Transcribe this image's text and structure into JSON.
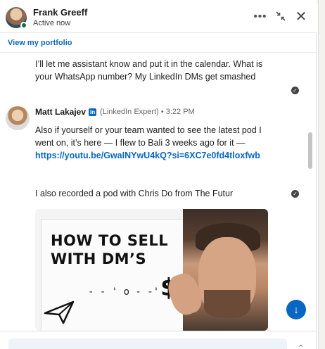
{
  "header": {
    "name": "Frank Greeff",
    "status": "Active now",
    "more_icon": "•••",
    "minimize_icon": "↘↖",
    "close_icon": "✕"
  },
  "portfolio": {
    "label": "View my portfolio"
  },
  "messages": {
    "first": {
      "text": "I’ll let me assistant know and put it in the calendar. What is your WhatsApp number? My LinkedIn DMs get smashed"
    },
    "second": {
      "sender": "Matt Lakajev",
      "badge": "in",
      "meta": "(LinkedIn Expert) • 3:22 PM",
      "text_before": "Also if yourself or your team wanted to see the latest pod I went on, it’s here — I flew to Bali 3 weeks ago for it — ",
      "link": "https://youtu.be/GwaINYwU4kQ?si=6XC7e0fd4tloxfwb",
      "text_after": "I also recorded a pod with Chris Do from The Futur"
    },
    "thumbnail": {
      "title_line1": "HOW TO SELL",
      "title_line2": "WITH DM’S",
      "dollar": "$"
    }
  },
  "icons": {
    "seen": "✓",
    "scroll_down": "↓",
    "expand": "⌃"
  },
  "colors": {
    "accent": "#0a66c2",
    "online": "#057642"
  }
}
